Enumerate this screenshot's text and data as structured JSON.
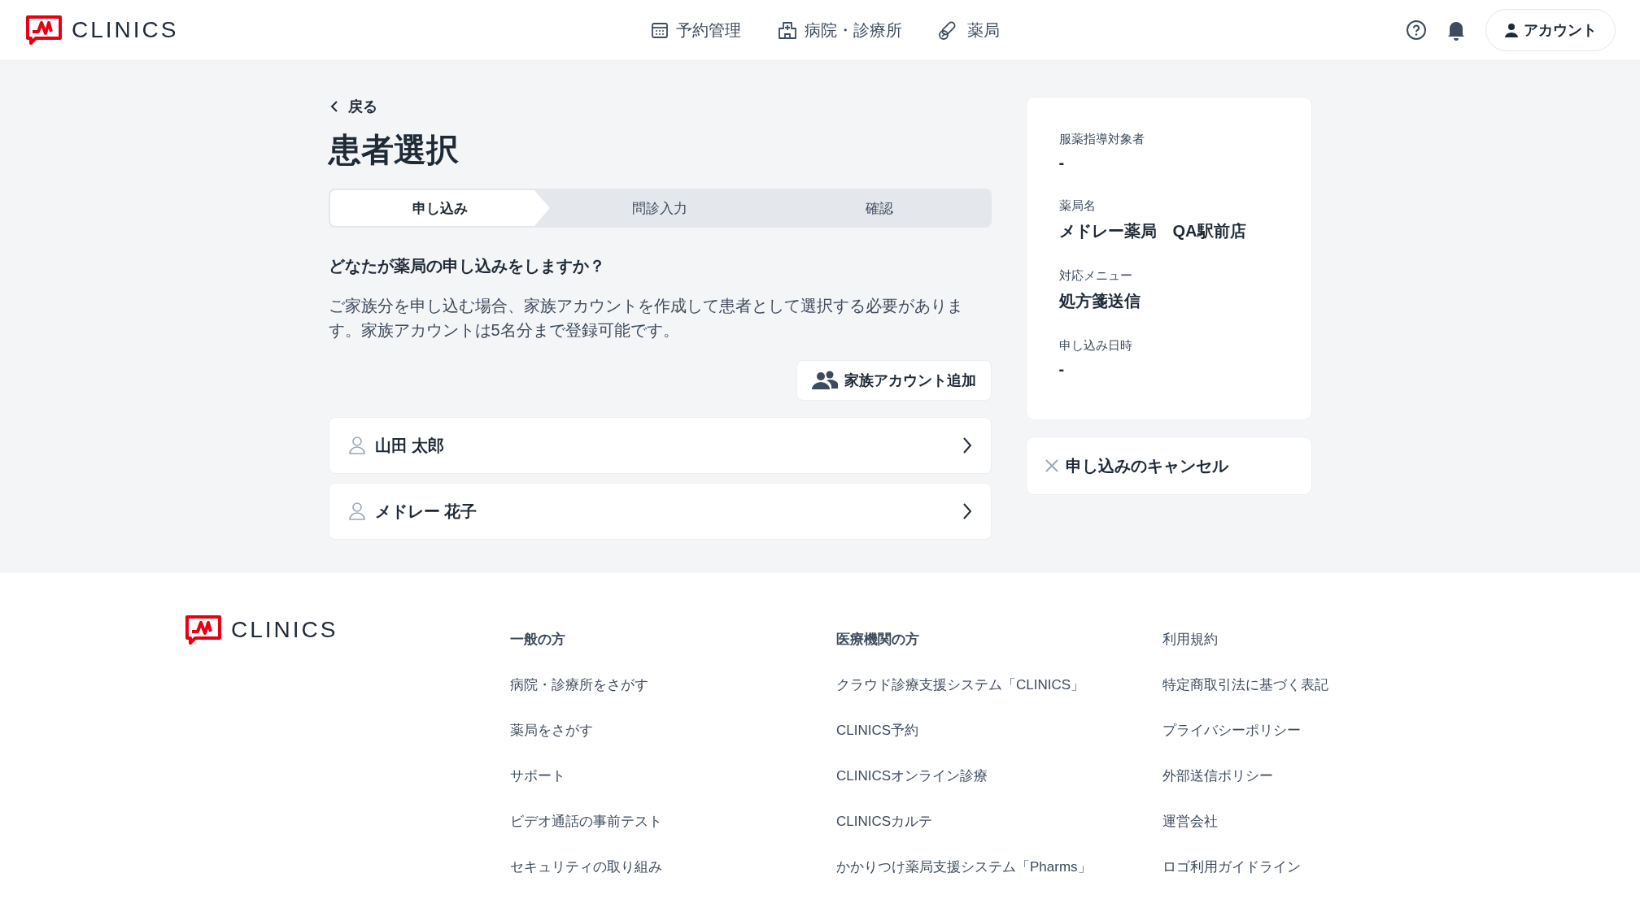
{
  "header": {
    "logo": "CLINICS",
    "nav": [
      {
        "label": "予約管理"
      },
      {
        "label": "病院・診療所"
      },
      {
        "label": "薬局"
      }
    ],
    "account": "アカウント"
  },
  "main": {
    "back": "戻る",
    "title": "患者選択",
    "steps": [
      {
        "label": "申し込み",
        "selected": true
      },
      {
        "label": "問診入力",
        "selected": false
      },
      {
        "label": "確認",
        "selected": false
      }
    ],
    "question": "どなたが薬局の申し込みをしますか？",
    "description": "ご家族分を申し込む場合、家族アカウントを作成して患者として選択する必要があります。家族アカウントは5名分まで登録可能です。",
    "add_button": "家族アカウント追加",
    "patients": [
      "山田 太郎",
      "メドレー 花子"
    ]
  },
  "summary": {
    "fields": [
      {
        "label": "服薬指導対象者",
        "value": "-"
      },
      {
        "label": "薬局名",
        "value": "メドレー薬局　QA駅前店"
      },
      {
        "label": "対応メニュー",
        "value": "処方箋送信"
      },
      {
        "label": "申し込み日時",
        "value": "-"
      }
    ],
    "cancel": "申し込みのキャンセル"
  },
  "footer": {
    "logo": "CLINICS",
    "columns": [
      {
        "heading": "一般の方",
        "links": [
          "病院・診療所をさがす",
          "薬局をさがす",
          "サポート",
          "ビデオ通話の事前テスト",
          "セキュリティの取り組み"
        ]
      },
      {
        "heading": "医療機関の方",
        "links": [
          "クラウド診療支援システム「CLINICS」",
          "CLINICS予約",
          "CLINICSオンライン診療",
          "CLINICSカルテ",
          "かかりつけ薬局支援システム「Pharms」"
        ]
      },
      {
        "links": [
          "利用規約",
          "特定商取引法に基づく表記",
          "プライバシーポリシー",
          "外部送信ポリシー",
          "運営会社",
          "ロゴ利用ガイドライン"
        ]
      }
    ]
  }
}
